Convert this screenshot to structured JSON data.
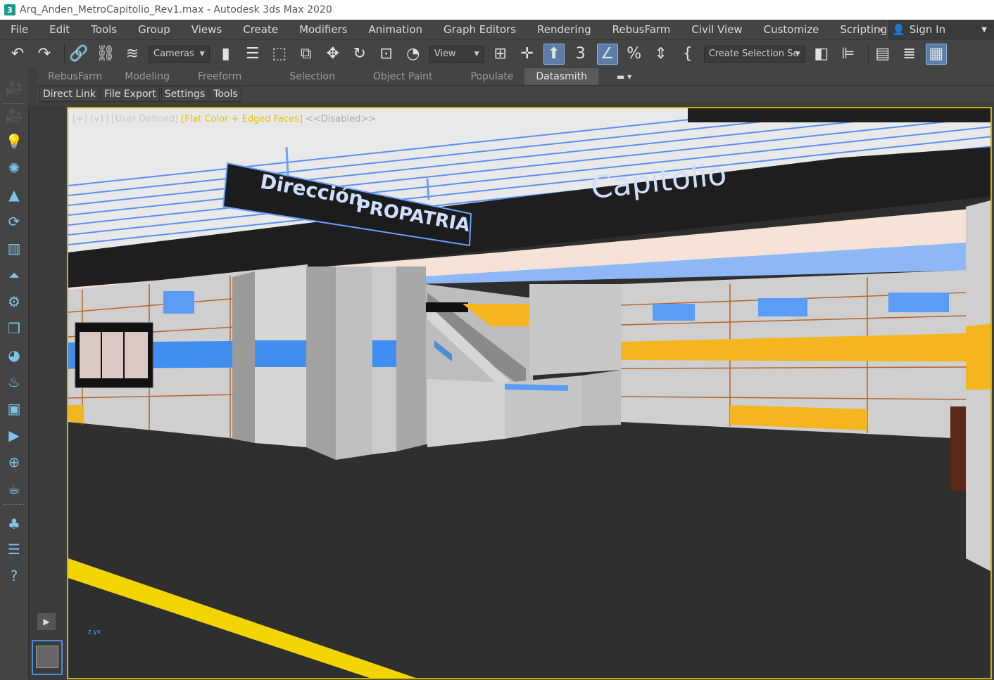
{
  "window": {
    "title": "Arq_Anden_MetroCapitolio_Rev1.max - Autodesk 3ds Max 2020",
    "app_icon": "3"
  },
  "menu": {
    "items": [
      "File",
      "Edit",
      "Tools",
      "Group",
      "Views",
      "Create",
      "Modifiers",
      "Animation",
      "Graph Editors",
      "Rendering",
      "RebusFarm",
      "Civil View",
      "Customize",
      "Scripting"
    ],
    "more": "»",
    "sign_in": "Sign In"
  },
  "toolbar": {
    "cameras_dropdown": "Cameras",
    "view_dropdown": "View",
    "selection_set_dropdown": "Create Selection Se"
  },
  "ribbon": {
    "tabs": [
      "RebusFarm",
      "Modeling",
      "Freeform",
      "Selection",
      "Object Paint",
      "Populate",
      "Datasmith"
    ],
    "active_tab": "Datasmith",
    "subtabs": [
      "Direct Link",
      "File Export",
      "Settings",
      "Tools"
    ]
  },
  "viewport": {
    "label_plus": "[+]",
    "label_view": "[v1]",
    "label_user": "[User Defined]",
    "label_shading": "[Flat Color + Edged Faces]",
    "label_disabled": "<<Disabled>>",
    "sign_direction": "Dirección",
    "sign_destination": "PROPATRIA",
    "station_name": "Capitolio",
    "axis_label": "z yx"
  },
  "colors": {
    "accent_blue": "#4a8fd6",
    "viewport_border": "#c8b400",
    "stripe_yellow": "#f5b51f",
    "stripe_blue": "#3f8ef0"
  }
}
